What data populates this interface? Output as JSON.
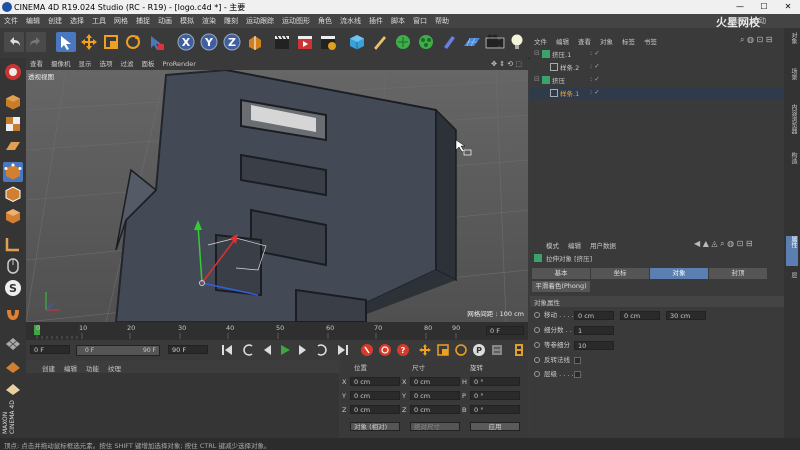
{
  "window": {
    "title": "CINEMA 4D R19.024 Studio (RC - R19) - [logo.c4d *] - 主要",
    "min": "—",
    "max": "☐",
    "close": "✕"
  },
  "menu": [
    "文件",
    "编辑",
    "创建",
    "选择",
    "工具",
    "网格",
    "捕捉",
    "动画",
    "模拟",
    "渲染",
    "雕刻",
    "运动跟踪",
    "运动图形",
    "角色",
    "流水线",
    "插件",
    "脚本",
    "窗口",
    "帮助"
  ],
  "layout_label": "界面:",
  "layout_value": "启动",
  "watermark": "火星网校",
  "viewport": {
    "menu": [
      "查看",
      "摄像机",
      "显示",
      "选项",
      "过滤",
      "面板",
      "ProRender"
    ],
    "name": "透视视图",
    "grid_info": "网格间距 : 100 cm"
  },
  "timeline": {
    "ticks": [
      "0",
      "10",
      "20",
      "30",
      "40",
      "50",
      "60",
      "70",
      "80",
      "90"
    ],
    "current_frame": "0 F",
    "start": "0 F",
    "slider_left": "0 F",
    "slider_right": "90 F",
    "end": "90 F"
  },
  "material_menu": [
    "创建",
    "编辑",
    "功能",
    "纹理"
  ],
  "coords": {
    "headers": [
      "位置",
      "尺寸",
      "旋转"
    ],
    "rows": [
      {
        "axis": "X",
        "pos": "0 cm",
        "size": "0 cm",
        "rlabel": "H",
        "rot": "0 °"
      },
      {
        "axis": "Y",
        "pos": "0 cm",
        "size": "0 cm",
        "rlabel": "P",
        "rot": "0 °"
      },
      {
        "axis": "Z",
        "pos": "0 cm",
        "size": "0 cm",
        "rlabel": "B",
        "rot": "0 °"
      }
    ],
    "mode": "对象 (相对)",
    "size_mode": "绝对尺寸",
    "apply": "应用"
  },
  "object_manager": {
    "menu": [
      "文件",
      "编辑",
      "查看",
      "对象",
      "标签",
      "书签"
    ],
    "items": [
      {
        "name": "挤压.1",
        "indent": 0,
        "selected": false
      },
      {
        "name": "样条.2",
        "indent": 1,
        "selected": false
      },
      {
        "name": "挤压",
        "indent": 0,
        "selected": false
      },
      {
        "name": "样条.1",
        "indent": 1,
        "selected": true
      }
    ]
  },
  "attributes": {
    "menu": [
      "模式",
      "编辑",
      "用户数据"
    ],
    "object_title": "拉伸对象 [挤压]",
    "tabs": [
      {
        "label": "基本",
        "active": false
      },
      {
        "label": "坐标",
        "active": false
      },
      {
        "label": "对象",
        "active": true
      },
      {
        "label": "封顶",
        "active": false
      }
    ],
    "phong_tab": "平滑着色(Phong)",
    "section": "对象属性",
    "move_label": "移动 . . . . .",
    "move_values": [
      "0 cm",
      "0 cm",
      "30 cm"
    ],
    "subdiv_label": "细分数 . . .",
    "subdiv_value": "1",
    "iso_label": "等参细分",
    "iso_value": "10",
    "flip_label": "反转法线",
    "hier_label": "层级 . . . . . ."
  },
  "right_strip": [
    "对象",
    "场景",
    "内容浏览器",
    "构造",
    "属性",
    "层"
  ],
  "left_brand": [
    "MAXON",
    "CINEMA 4D"
  ],
  "status": "顶点: 点击并拖动鼠标框选元素。按住 SHIFT 键增加选择对象; 按住 CTRL 键减少选择对象。",
  "colors": {
    "accent": "#4a78c0",
    "play": "#3ea63e",
    "record": "#d63a2a",
    "axis_y": "#33cc33",
    "axis_x": "#e03030",
    "axis_z": "#3060e0"
  }
}
